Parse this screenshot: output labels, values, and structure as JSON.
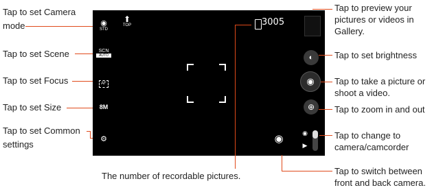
{
  "left_callouts": {
    "camera_mode": "Tap to set Camera mode",
    "camera_mode_l1": "Tap to set Camera",
    "camera_mode_l2": "mode",
    "scene": "Tap to set Scene",
    "focus": "Tap to set Focus",
    "size": "Tap to set Size",
    "common_l1": "Tap to set Common",
    "common_l2": "settings"
  },
  "right_callouts": {
    "preview": "Tap to preview your pictures or videos in Gallery.",
    "brightness": "Tap to set brightness",
    "shutter": "Tap to take a picture or shoot a video.",
    "zoom": "Tap to zoom in and out",
    "mode_switch": "Tap to change to camera/camcorder",
    "front_back": "Tap to switch between front and back camera."
  },
  "bottom_callouts": {
    "recordable": "The number of recordable pictures."
  },
  "viewfinder": {
    "std_label": "STD",
    "top_label": "TOP",
    "scn_label": "SCN",
    "scn_sub": "AUTO",
    "af_label": "AF",
    "size_label": "8M",
    "counter": "3005"
  },
  "colors": {
    "leader": "#e04a1a",
    "viewfinder": "#000000"
  },
  "icons": {
    "camera_mode": "camera-icon",
    "top": "arrow-up-icon",
    "scene": "scene-icon",
    "focus": "focus-icon",
    "settings": "gear-camera-icon",
    "storage": "sd-card-icon",
    "brightness": "brightness-icon",
    "shutter": "camera-icon",
    "zoom": "zoom-icon",
    "switch_camera": "switch-camera-icon",
    "mode_camera": "camera-icon",
    "mode_video": "video-icon"
  }
}
